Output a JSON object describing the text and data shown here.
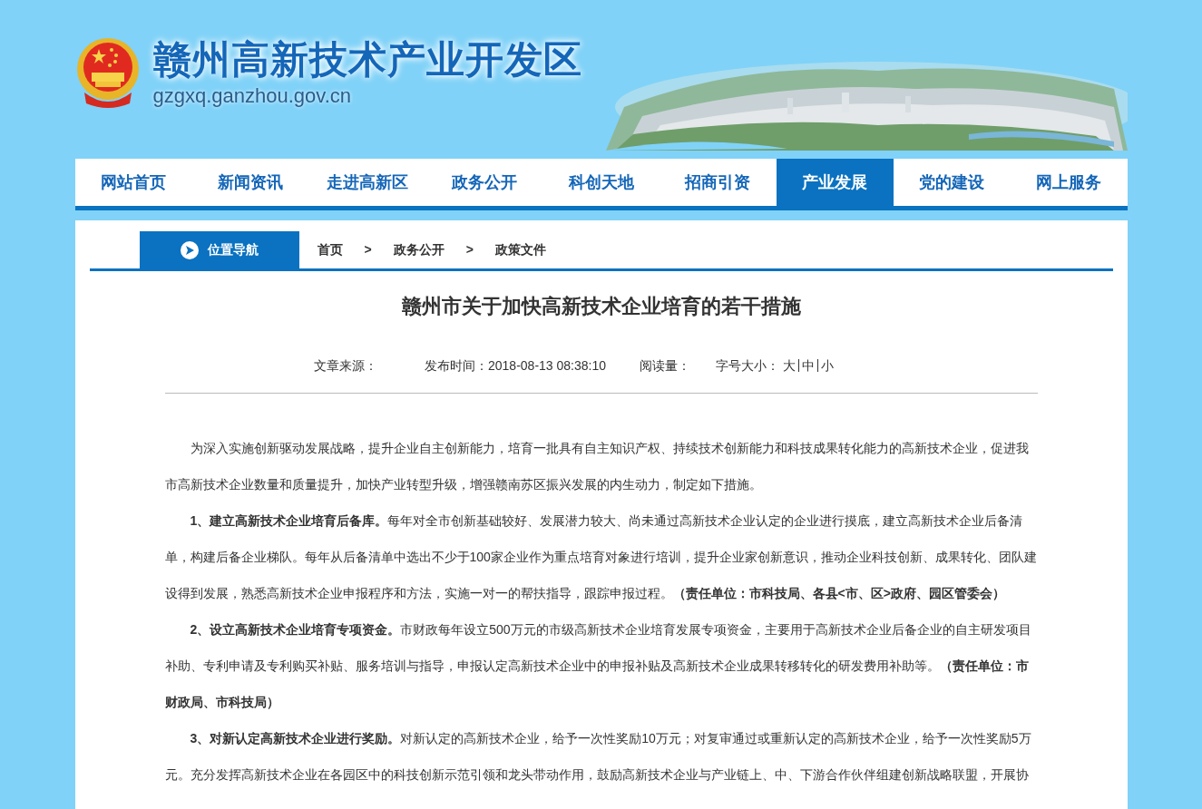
{
  "header": {
    "site_title": "赣州高新技术产业开发区",
    "site_url": "gzgxq.ganzhou.gov.cn"
  },
  "nav": [
    {
      "label": "网站首页",
      "selected": false
    },
    {
      "label": "新闻资讯",
      "selected": false
    },
    {
      "label": "走进高新区",
      "selected": false
    },
    {
      "label": "政务公开",
      "selected": false
    },
    {
      "label": "科创天地",
      "selected": false
    },
    {
      "label": "招商引资",
      "selected": false
    },
    {
      "label": "产业发展",
      "selected": true
    },
    {
      "label": "党的建设",
      "selected": false
    },
    {
      "label": "网上服务",
      "selected": false
    }
  ],
  "breadcrumb": {
    "label": "位置导航",
    "items": [
      "首页",
      "政务公开",
      "政策文件"
    ],
    "separator": ">"
  },
  "article": {
    "title": "赣州市关于加快高新技术企业培育的若干措施",
    "meta": [
      "文章来源：",
      "发布时间：2018-08-13 08:38:10",
      "阅读量："
    ],
    "font_size": {
      "label": "字号大小：",
      "options": [
        "大",
        "中",
        "小"
      ]
    },
    "paragraphs": [
      "为深入实施创新驱动发展战略，提升企业自主创新能力，培育一批具有自主知识产权、持续技术创新能力和科技成果转化能力的高新技术企业，促进我市高新技术企业数量和质量提升，加快产业转型升级，增强赣南苏区振兴发展的内生动力，制定如下措施。",
      "**1、建立高新技术企业培育后备库。**每年对全市创新基础较好、发展潜力较大、尚未通过高新技术企业认定的企业进行摸底，建立高新技术企业后备清单，构建后备企业梯队。每年从后备清单中选出不少于100家企业作为重点培育对象进行培训，提升企业家创新意识，推动企业科技创新、成果转化、团队建设得到发展，熟悉高新技术企业申报程序和方法，实施一对一的帮扶指导，跟踪申报过程。**（责任单位：市科技局、各县<市、区>政府、园区管委会）**",
      "**2、设立高新技术企业培育专项资金。**市财政每年设立500万元的市级高新技术企业培育发展专项资金，主要用于高新技术企业后备企业的自主研发项目补助、专利申请及专利购买补贴、服务培训与指导，申报认定高新技术企业中的申报补贴及高新技术企业成果转移转化的研发费用补助等。**（责任单位：市财政局、市科技局）**",
      "**3、对新认定高新技术企业进行奖励。**对新认定的高新技术企业，给予一次性奖励10万元；对复审通过或重新认定的高新技术企业，给予一次性奖励5万元。充分发挥高新技术企业在各园区中的科技创新示范引领和龙头带动作用，鼓励高新技术企业与产业链上、中、下游合作伙伴组建创新战略联盟，开展协"
    ]
  }
}
